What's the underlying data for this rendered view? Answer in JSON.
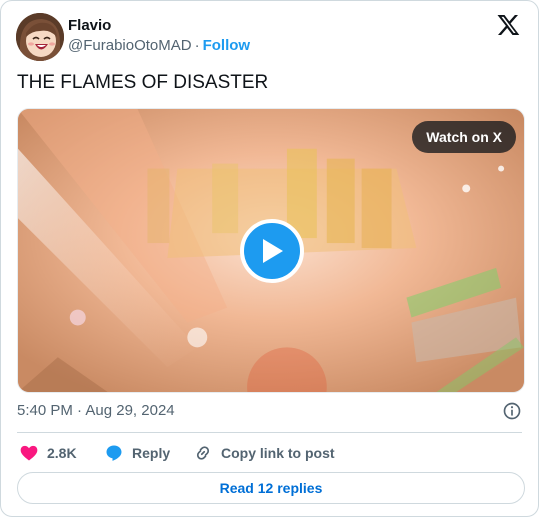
{
  "author": {
    "display_name": "Flavio",
    "handle": "@FurabioOtoMAD",
    "separator": "·",
    "follow_label": "Follow"
  },
  "tweet": {
    "text": "THE FLAMES OF DISASTER"
  },
  "media": {
    "watch_label": "Watch on X",
    "type": "video"
  },
  "meta": {
    "time": "5:40 PM",
    "separator": "·",
    "date": "Aug 29, 2024"
  },
  "actions": {
    "likes_count": "2.8K",
    "reply_label": "Reply",
    "copy_label": "Copy link to post"
  },
  "replies_button": {
    "label": "Read 12 replies"
  },
  "colors": {
    "accent": "#1d9bf0",
    "like": "#f91880",
    "link": "#006fd6",
    "muted": "#536471",
    "text": "#0f1419",
    "border": "#cfd9de"
  },
  "icons": [
    "x-logo-icon",
    "play-icon",
    "info-icon",
    "heart-icon",
    "reply-bubble-icon",
    "link-icon"
  ]
}
